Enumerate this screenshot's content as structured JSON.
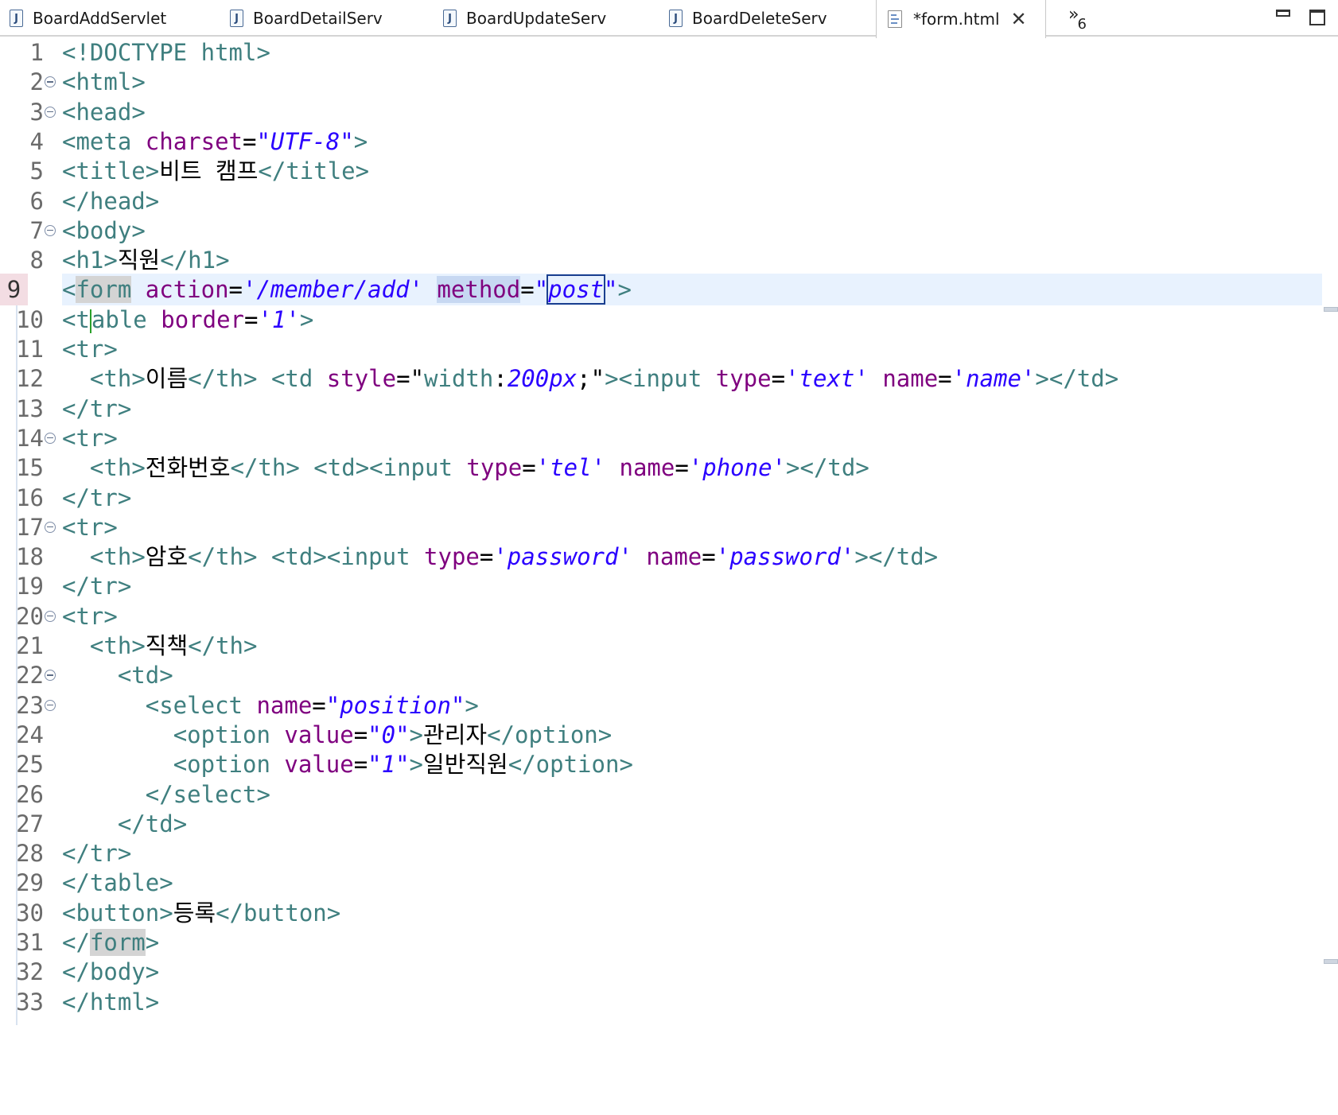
{
  "tabs": [
    {
      "label": "BoardAddServlet",
      "icon": "java-file-icon",
      "active": false
    },
    {
      "label": "BoardDetailServ",
      "icon": "java-file-icon",
      "active": false
    },
    {
      "label": "BoardUpdateServ",
      "icon": "java-file-icon",
      "active": false
    },
    {
      "label": "BoardDeleteServ",
      "icon": "java-file-icon",
      "active": false
    },
    {
      "label": "*form.html",
      "icon": "html-file-icon",
      "active": true
    }
  ],
  "overflow": {
    "glyph": "»",
    "count": "6"
  },
  "window_controls": {
    "minimize": "minimize-icon",
    "maximize": "maximize-icon"
  },
  "current_line": 9,
  "colors": {
    "tag": "#3f7f7f",
    "attribute": "#7f007f",
    "string": "#2a00ff",
    "current_line_bg": "#e8f2fe",
    "fold_marker": "#7f8ea8"
  },
  "code_lines": [
    {
      "n": "1",
      "text": "<!DOCTYPE html>"
    },
    {
      "n": "2",
      "text": "<html>",
      "fold": true
    },
    {
      "n": "3",
      "text": "<head>",
      "fold": true
    },
    {
      "n": "4",
      "text": "<meta charset=\"UTF-8\">"
    },
    {
      "n": "5",
      "text": "<title>비트 캠프</title>"
    },
    {
      "n": "6",
      "text": "</head>"
    },
    {
      "n": "7",
      "text": "<body>",
      "fold": true
    },
    {
      "n": "8",
      "text": "<h1>직원</h1>"
    },
    {
      "n": "9",
      "text": "<form action='/member/add' method=\"post\">"
    },
    {
      "n": "10",
      "text": "<table border='1'>"
    },
    {
      "n": "11",
      "text": "<tr>"
    },
    {
      "n": "12",
      "text": "  <th>이름</th> <td style=\"width:200px;\"><input type='text' name='name'></td>"
    },
    {
      "n": "13",
      "text": "</tr>"
    },
    {
      "n": "14",
      "text": "<tr>",
      "fold": true
    },
    {
      "n": "15",
      "text": "  <th>전화번호</th> <td><input type='tel' name='phone'></td>"
    },
    {
      "n": "16",
      "text": "</tr>"
    },
    {
      "n": "17",
      "text": "<tr>",
      "fold": true
    },
    {
      "n": "18",
      "text": "  <th>암호</th> <td><input type='password' name='password'></td>"
    },
    {
      "n": "19",
      "text": "</tr>"
    },
    {
      "n": "20",
      "text": "<tr>",
      "fold": true
    },
    {
      "n": "21",
      "text": "  <th>직책</th>"
    },
    {
      "n": "22",
      "text": "    <td>",
      "fold": true
    },
    {
      "n": "23",
      "text": "      <select name=\"position\">",
      "fold": true
    },
    {
      "n": "24",
      "text": "        <option value=\"0\">관리자</option>"
    },
    {
      "n": "25",
      "text": "        <option value=\"1\">일반직원</option>"
    },
    {
      "n": "26",
      "text": "      </select>"
    },
    {
      "n": "27",
      "text": "    </td>"
    },
    {
      "n": "28",
      "text": "</tr>"
    },
    {
      "n": "29",
      "text": "</table>"
    },
    {
      "n": "30",
      "text": "<button>등록</button>"
    },
    {
      "n": "31",
      "text": "</form>"
    },
    {
      "n": "32",
      "text": "</body>"
    },
    {
      "n": "33",
      "text": "</html>"
    }
  ]
}
